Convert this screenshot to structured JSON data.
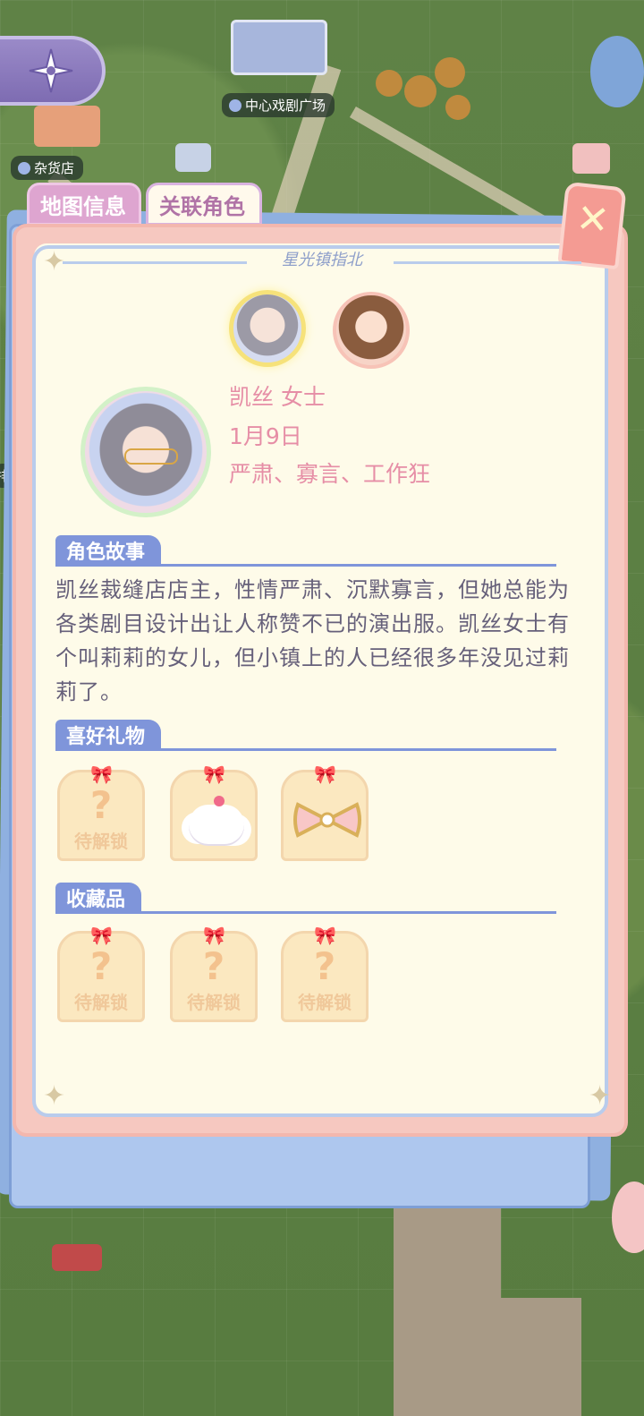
{
  "map": {
    "labels": {
      "theater": "中心戏剧广场",
      "store": "杂货店",
      "left_edge": "排"
    }
  },
  "tabs": {
    "map_info": "地图信息",
    "related_characters": "关联角色"
  },
  "panel": {
    "header_script": "星光镇指北",
    "character": {
      "name": "凯丝 女士",
      "birthday": "1月9日",
      "traits": "严肃、寡言、工作狂"
    },
    "story_title": "角色故事",
    "story_text": "凯丝裁缝店店主，性情严肃、沉默寡言，但她总能为各类剧目设计出让人称赞不已的演出服。凯丝女士有个叫莉莉的女儿，但小镇上的人已经很多年没见过莉莉了。",
    "gifts_title": "喜好礼物",
    "gifts": [
      {
        "label": "待解锁",
        "locked": true
      },
      {
        "label": "",
        "locked": false,
        "item": "cloud-cake"
      },
      {
        "label": "",
        "locked": false,
        "item": "bow-cookie"
      }
    ],
    "collectibles_title": "收藏品",
    "collectibles": [
      {
        "label": "待解锁",
        "locked": true
      },
      {
        "label": "待解锁",
        "locked": true
      },
      {
        "label": "待解锁",
        "locked": true
      }
    ]
  },
  "icons": {
    "close": "close-icon",
    "compass": "compass-icon"
  },
  "colors": {
    "accent": "#7f95da",
    "pink_text": "#e68ea6",
    "panel_bg": "#fefbe9"
  }
}
